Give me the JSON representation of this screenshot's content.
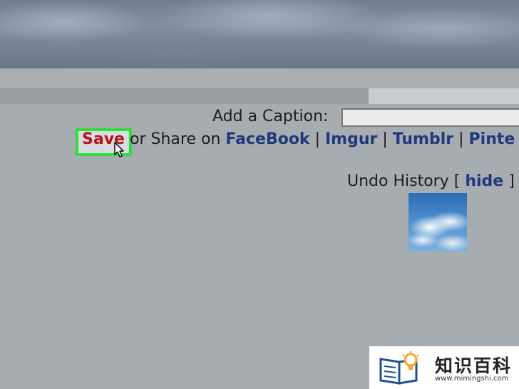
{
  "caption": {
    "label": "Add a Caption:",
    "value": ""
  },
  "actions": {
    "save_label": "Save",
    "share_text": "or Share on",
    "links": [
      "FaceBook",
      "Imgur",
      "Tumblr",
      "Pinte"
    ],
    "separator": "|"
  },
  "undo_history": {
    "label": "Undo History [",
    "toggle_label": "hide",
    "close_bracket": "]"
  },
  "watermark": {
    "title": "知识百科",
    "url": "www.mimingshi.com"
  },
  "colors": {
    "highlight": "#2ede3a",
    "save_red": "#b5151d",
    "link_blue": "#1f3a7a"
  }
}
